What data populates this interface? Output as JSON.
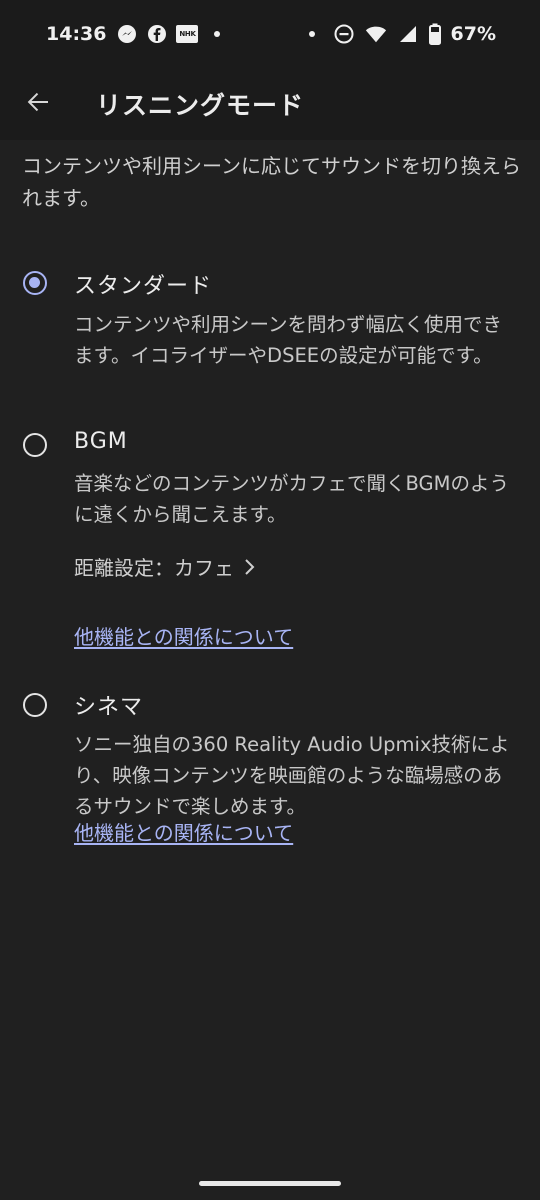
{
  "status_bar": {
    "time": "14:36",
    "battery_percent": "67%",
    "notification_icons": [
      "messenger-icon",
      "facebook-icon",
      "nhk-icon",
      "more-dot-icon"
    ],
    "nhk_label": "NHK",
    "system_icons": [
      "dnd-icon",
      "wifi-icon",
      "signal-icon",
      "battery-icon"
    ]
  },
  "app_bar": {
    "title": "リスニングモード",
    "back_icon": "arrow-back-icon"
  },
  "description": "コンテンツや利用シーンに応じてサウンドを切り換えられます。",
  "options": [
    {
      "title": "スタンダード",
      "selected": true,
      "description": "コンテンツや利用シーンを問わず幅広く使用できます。イコライザーやDSEEの設定が可能です。"
    },
    {
      "title": "BGM",
      "selected": false,
      "description": "音楽などのコンテンツがカフェで聞くBGMのように遠くから聞こえます。",
      "distance_setting": "距離設定：カフェ",
      "link": "他機能との関係について"
    },
    {
      "title": "シネマ",
      "selected": false,
      "description": "ソニー独自の360 Reality Audio Upmix技術により、映像コンテンツを映画館のような臨場感のあるサウンドで楽しめます。",
      "link": "他機能との関係について"
    }
  ],
  "colors": {
    "background": "#202020",
    "accent": "#a8b4f4",
    "text_primary": "#ececec",
    "text_secondary": "#c8c8c8"
  }
}
